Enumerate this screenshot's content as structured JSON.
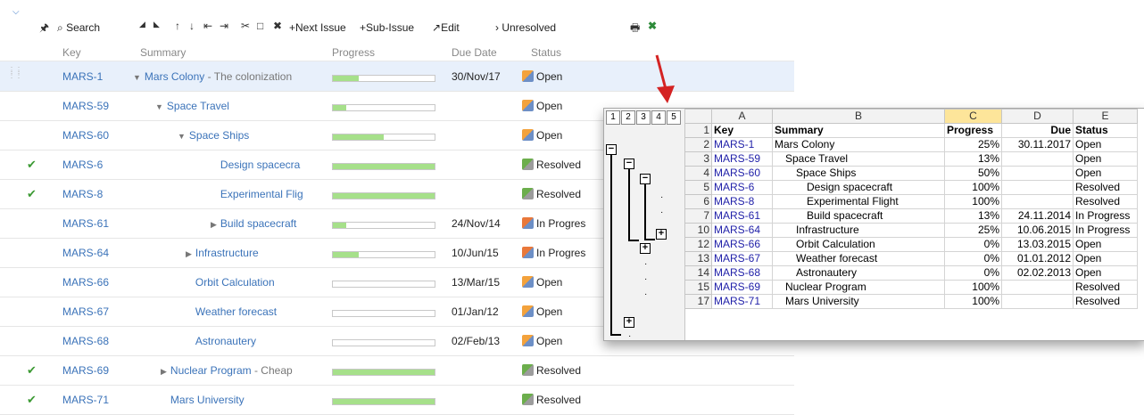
{
  "toolbar": {
    "search_label": "Search",
    "next_issue_label": "Next Issue",
    "sub_issue_label": "Sub-Issue",
    "edit_label": "Edit",
    "unresolved_label": "Unresolved"
  },
  "columns": {
    "key": "Key",
    "summary": "Summary",
    "progress": "Progress",
    "due": "Due Date",
    "status": "Status"
  },
  "rows": [
    {
      "key": "MARS-1",
      "summary": "Mars Colony",
      "desc": "- The colonization",
      "progress": 0.25,
      "due": "30/Nov/17",
      "status": "Open",
      "resolved": false
    },
    {
      "key": "MARS-59",
      "summary": "Space Travel",
      "desc": "",
      "progress": 0.13,
      "due": "",
      "status": "Open",
      "resolved": false
    },
    {
      "key": "MARS-60",
      "summary": "Space Ships",
      "desc": "",
      "progress": 0.5,
      "due": "",
      "status": "Open",
      "resolved": false
    },
    {
      "key": "MARS-6",
      "summary": "Design spacecra",
      "desc": "",
      "progress": 1.0,
      "due": "",
      "status": "Resolved",
      "resolved": true
    },
    {
      "key": "MARS-8",
      "summary": "Experimental Flig",
      "desc": "",
      "progress": 1.0,
      "due": "",
      "status": "Resolved",
      "resolved": true
    },
    {
      "key": "MARS-61",
      "summary": "Build spacecraft",
      "desc": "",
      "progress": 0.13,
      "due": "24/Nov/14",
      "status": "In Progres",
      "resolved": false
    },
    {
      "key": "MARS-64",
      "summary": "Infrastructure",
      "desc": "",
      "progress": 0.25,
      "due": "10/Jun/15",
      "status": "In Progres",
      "resolved": false
    },
    {
      "key": "MARS-66",
      "summary": "Orbit Calculation",
      "desc": "",
      "progress": 0.0,
      "due": "13/Mar/15",
      "status": "Open",
      "resolved": false
    },
    {
      "key": "MARS-67",
      "summary": "Weather forecast",
      "desc": "",
      "progress": 0.0,
      "due": "01/Jan/12",
      "status": "Open",
      "resolved": false
    },
    {
      "key": "MARS-68",
      "summary": "Astronautery",
      "desc": "",
      "progress": 0.0,
      "due": "02/Feb/13",
      "status": "Open",
      "resolved": false
    },
    {
      "key": "MARS-69",
      "summary": "Nuclear Program",
      "desc": "- Cheap",
      "progress": 1.0,
      "due": "",
      "status": "Resolved",
      "resolved": true
    },
    {
      "key": "MARS-71",
      "summary": "Mars University",
      "desc": "",
      "progress": 1.0,
      "due": "",
      "status": "Resolved",
      "resolved": true
    }
  ],
  "excel": {
    "outline_levels": [
      "1",
      "2",
      "3",
      "4",
      "5"
    ],
    "col_letters": [
      "A",
      "B",
      "C",
      "D",
      "E"
    ],
    "header": {
      "row": "1",
      "key": "Key",
      "summary": "Summary",
      "progress": "Progress",
      "due": "Due",
      "status": "Status"
    },
    "rows": [
      {
        "n": "2",
        "key": "MARS-1",
        "summary": "Mars Colony",
        "progress": "25%",
        "due": "30.11.2017",
        "status": "Open"
      },
      {
        "n": "3",
        "key": "MARS-59",
        "summary": "Space Travel",
        "progress": "13%",
        "due": "",
        "status": "Open"
      },
      {
        "n": "4",
        "key": "MARS-60",
        "summary": "Space Ships",
        "progress": "50%",
        "due": "",
        "status": "Open"
      },
      {
        "n": "5",
        "key": "MARS-6",
        "summary": "Design spacecraft",
        "progress": "100%",
        "due": "",
        "status": "Resolved"
      },
      {
        "n": "6",
        "key": "MARS-8",
        "summary": "Experimental Flight",
        "progress": "100%",
        "due": "",
        "status": "Resolved"
      },
      {
        "n": "7",
        "key": "MARS-61",
        "summary": "Build spacecraft",
        "progress": "13%",
        "due": "24.11.2014",
        "status": "In Progress"
      },
      {
        "n": "10",
        "key": "MARS-64",
        "summary": "Infrastructure",
        "progress": "25%",
        "due": "10.06.2015",
        "status": "In Progress"
      },
      {
        "n": "12",
        "key": "MARS-66",
        "summary": "Orbit Calculation",
        "progress": "0%",
        "due": "13.03.2015",
        "status": "Open"
      },
      {
        "n": "13",
        "key": "MARS-67",
        "summary": "Weather forecast",
        "progress": "0%",
        "due": "01.01.2012",
        "status": "Open"
      },
      {
        "n": "14",
        "key": "MARS-68",
        "summary": "Astronautery",
        "progress": "0%",
        "due": "02.02.2013",
        "status": "Open"
      },
      {
        "n": "15",
        "key": "MARS-69",
        "summary": "Nuclear Program",
        "progress": "100%",
        "due": "",
        "status": "Resolved"
      },
      {
        "n": "17",
        "key": "MARS-71",
        "summary": "Mars University",
        "progress": "100%",
        "due": "",
        "status": "Resolved"
      }
    ]
  },
  "colors": {
    "accent": "#3b73b9",
    "progress_fill": "#a6e08a",
    "selected_row": "#e8f0fb",
    "excel_selected_col": "#fde59a"
  }
}
